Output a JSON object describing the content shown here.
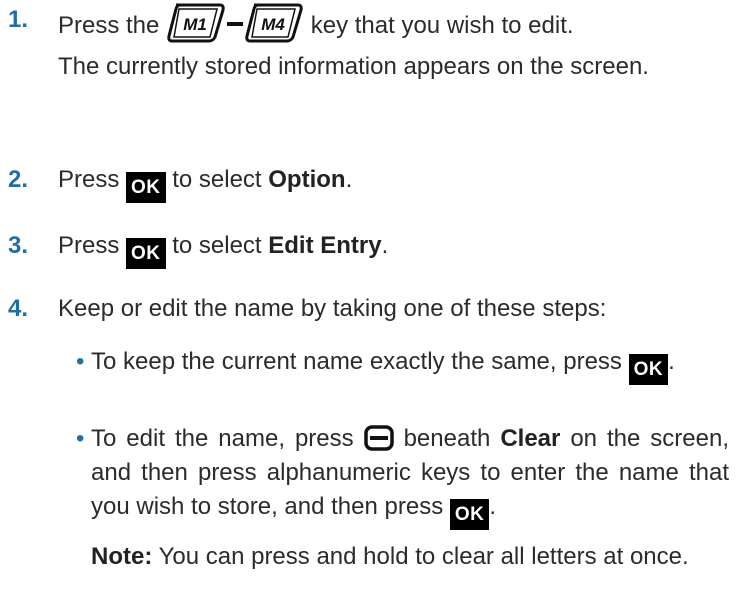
{
  "steps": [
    {
      "number": "1.",
      "before": "Press the",
      "key_m1": "M1",
      "key_m4": "M4",
      "after": "key that you wish to edit.",
      "line2": "The currently stored information appears on the screen."
    },
    {
      "number": "2.",
      "before": "Press",
      "ok": "OK",
      "middle": "to select",
      "bold": "Option",
      "end": "."
    },
    {
      "number": "3.",
      "before": "Press",
      "ok": "OK",
      "middle": "to select",
      "bold": "Edit Entry",
      "end": "."
    },
    {
      "number": "4.",
      "text": "Keep or edit the name by taking one of these steps:"
    }
  ],
  "bullets": [
    {
      "bullet": "•",
      "text": "To keep the current name exactly the same, press",
      "ok": "OK",
      "end": "."
    },
    {
      "bullet": "•",
      "text1": "To edit the name, press",
      "text2": "beneath",
      "bold": "Clear",
      "text3": "on the screen, and then press alphanumeric keys to enter the name that you wish to store, and then press",
      "ok": "OK",
      "end": "."
    }
  ],
  "note": {
    "label": "Note:",
    "text": "You can press and hold to clear all letters at once."
  }
}
